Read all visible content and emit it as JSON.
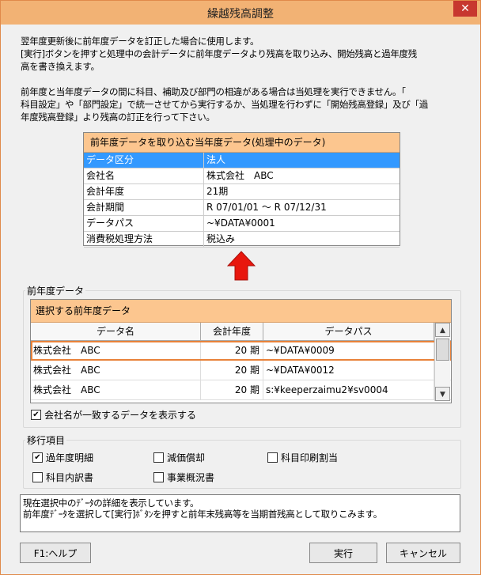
{
  "window": {
    "title": "繰越残高調整",
    "close_glyph": "✕"
  },
  "description": {
    "line1": "翌年度更新後に前年度データを訂正した場合に使用します。",
    "line2": "[実行]ボタンを押すと処理中の会計データに前年度データより残高を取り込み、開始残高と過年度残",
    "line3": "高を書き換えます。",
    "line4": "前年度と当年度データの間に科目、補助及び部門の相違がある場合は当処理を実行できません。「",
    "line5": "科目設定」や「部門設定」で統一させてから実行するか、当処理を行わずに「開始残高登録」及び「過",
    "line6": "年度残高登録」より残高の訂正を行って下さい。"
  },
  "current_data": {
    "header": "前年度データを取り込む当年度データ(処理中のデータ)",
    "rows": [
      {
        "key": "データ区分",
        "value": "法人"
      },
      {
        "key": "会社名",
        "value": "株式会社　ABC"
      },
      {
        "key": "会計年度",
        "value": "21期"
      },
      {
        "key": "会計期間",
        "value": "R 07/01/01 ～ R 07/12/31"
      },
      {
        "key": "データパス",
        "value": "~¥DATA¥0001"
      },
      {
        "key": "消費税処理方法",
        "value": "税込み"
      }
    ]
  },
  "previous_data": {
    "group_label": "前年度データ",
    "header": "選択する前年度データ",
    "columns": [
      "データ名",
      "会計年度",
      "データパス"
    ],
    "rows": [
      {
        "name": "株式会社　ABC",
        "year": "20 期",
        "path": "~¥DATA¥0009"
      },
      {
        "name": "株式会社　ABC",
        "year": "20 期",
        "path": "~¥DATA¥0012"
      },
      {
        "name": "株式会社　ABC",
        "year": "20 期",
        "path": "s:¥keeperzaimu2¥sv0004"
      }
    ],
    "match_checkbox": "会社名が一致するデータを表示する"
  },
  "transfer_items": {
    "group_label": "移行項目",
    "items": [
      {
        "label": "過年度明細",
        "checked": true
      },
      {
        "label": "減価償却",
        "checked": false
      },
      {
        "label": "科目印刷割当",
        "checked": false
      },
      {
        "label": "科目内訳書",
        "checked": false
      },
      {
        "label": "事業概況書",
        "checked": false
      }
    ]
  },
  "status": {
    "line1": "現在選択中のﾃﾞｰﾀの詳細を表示しています。",
    "line2": "前年度ﾃﾞｰﾀを選択して[実行]ﾎﾞﾀﾝを押すと前年末残高等を当期首残高として取りこみます。"
  },
  "buttons": {
    "help": "F1:ヘルプ",
    "run": "実行",
    "cancel": "キャンセル"
  },
  "icons": {
    "arrow": "up-arrow-icon",
    "check": "✔",
    "scroll_up": "▲",
    "scroll_down": "▼"
  },
  "colors": {
    "titlebar": "#f2b274",
    "panel_header": "#fcc68f",
    "selected_row": "#3399ff",
    "selected_outline": "#e8823a",
    "arrow": "#e8170e"
  }
}
